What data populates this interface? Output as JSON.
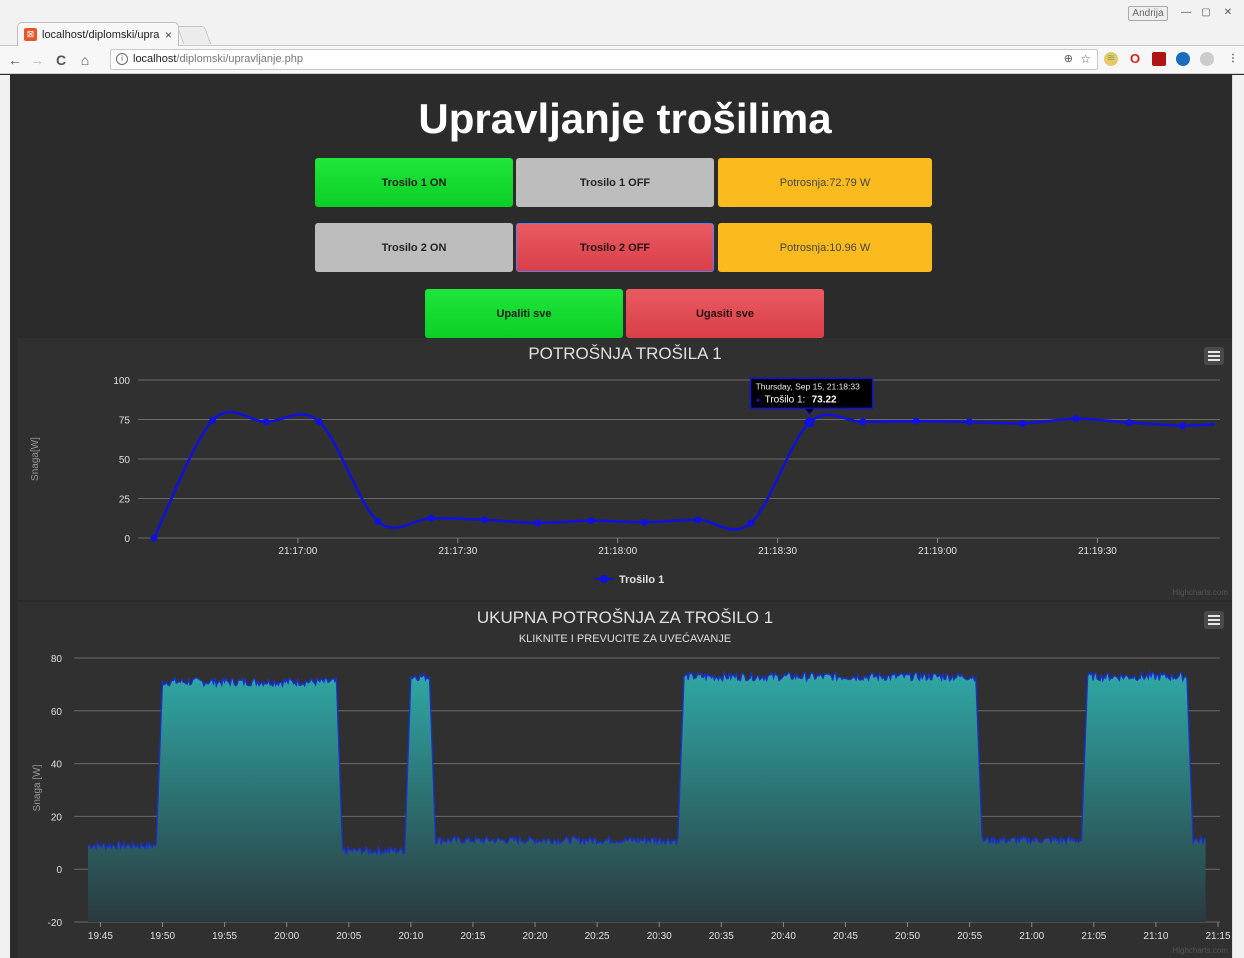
{
  "browser": {
    "tab_title": "localhost/diplomski/upra",
    "tab_close": "×",
    "user": "Andrija",
    "url_host": "localhost",
    "url_path": "/diplomski/upravljanje.php",
    "nav_back": "←",
    "nav_forward": "→",
    "nav_reload": "C",
    "nav_home": "⌂"
  },
  "page": {
    "title": "Upravljanje trošilima",
    "buttons": {
      "t1_on": "Trosilo 1 ON",
      "t1_off": "Trosilo 1 OFF",
      "t1_power": "Potrosnja:72.79 W",
      "t2_on": "Trosilo 2 ON",
      "t2_off": "Trosilo 2 OFF",
      "t2_power": "Potrosnja:10.96 W",
      "all_on": "Upaliti sve",
      "all_off": "Ugasiti sve"
    },
    "colors": {
      "green": "#0bcf25",
      "red": "#d93f48",
      "gray": "#bdbdbd",
      "yellow": "#fbbb1e",
      "series_line": "#1010e0",
      "area_fill": "#2a9a9a"
    }
  },
  "chart_data": [
    {
      "type": "line",
      "title": "POTROŠNJA TROŠILA 1",
      "ylabel": "Snaga[W]",
      "ylim": [
        0,
        100
      ],
      "yticks": [
        0,
        25,
        50,
        75,
        100
      ],
      "xticks": [
        "21:17:00",
        "21:17:30",
        "21:18:00",
        "21:18:30",
        "21:19:00",
        "21:19:30"
      ],
      "xtick_seconds": [
        60,
        90,
        120,
        150,
        180,
        210
      ],
      "series": [
        {
          "name": "Trošilo 1",
          "x": [
            33,
            44,
            54,
            64,
            75,
            85,
            95,
            105,
            115,
            125,
            135,
            145,
            156,
            166,
            176,
            186,
            196,
            206,
            216,
            226
          ],
          "y": [
            0,
            74.5,
            73.5,
            73.5,
            10.5,
            12.5,
            11.5,
            9.5,
            11,
            10,
            11.5,
            9.5,
            73.22,
            73.5,
            74,
            73.5,
            72.5,
            75.5,
            73,
            71
          ]
        }
      ],
      "x_end": 232,
      "y_end": 72,
      "tooltip": {
        "date": "Thursday, Sep 15, 21:18:33",
        "series": "Trošilo 1:",
        "value": "73.22"
      },
      "legend": "bottom-center",
      "credits": "Highcharts.com"
    },
    {
      "type": "area",
      "title": "UKUPNA POTROŠNJA ZA TROŠILO 1",
      "subtitle": "KLIKNITE I PREVUCITE ZA UVEĆAVANJE",
      "ylabel": "Snaga [W]",
      "ylim": [
        -20,
        80
      ],
      "yticks": [
        -20,
        0,
        20,
        40,
        60,
        80
      ],
      "xticks": [
        "19:45",
        "19:50",
        "19:55",
        "20:00",
        "20:05",
        "20:10",
        "20:15",
        "20:20",
        "20:25",
        "20:30",
        "20:35",
        "20:40",
        "20:45",
        "20:50",
        "20:55",
        "21:00",
        "21:05",
        "21:10",
        "21:15"
      ],
      "segments": [
        {
          "from": "19:44",
          "to": "19:49.5",
          "level": 9
        },
        {
          "from": "19:50",
          "to": "20:04",
          "level": 71
        },
        {
          "from": "20:04.5",
          "to": "20:09.5",
          "level": 7
        },
        {
          "from": "20:10",
          "to": "20:11.5",
          "level": 73
        },
        {
          "from": "20:12",
          "to": "20:31.5",
          "level": 11
        },
        {
          "from": "20:32",
          "to": "20:55.5",
          "level": 73
        },
        {
          "from": "20:56",
          "to": "21:04",
          "level": 11
        },
        {
          "from": "21:04.5",
          "to": "21:12.5",
          "level": 73
        },
        {
          "from": "21:13",
          "to": "21:14",
          "level": 11
        }
      ],
      "credits": "Highcharts.com"
    }
  ]
}
